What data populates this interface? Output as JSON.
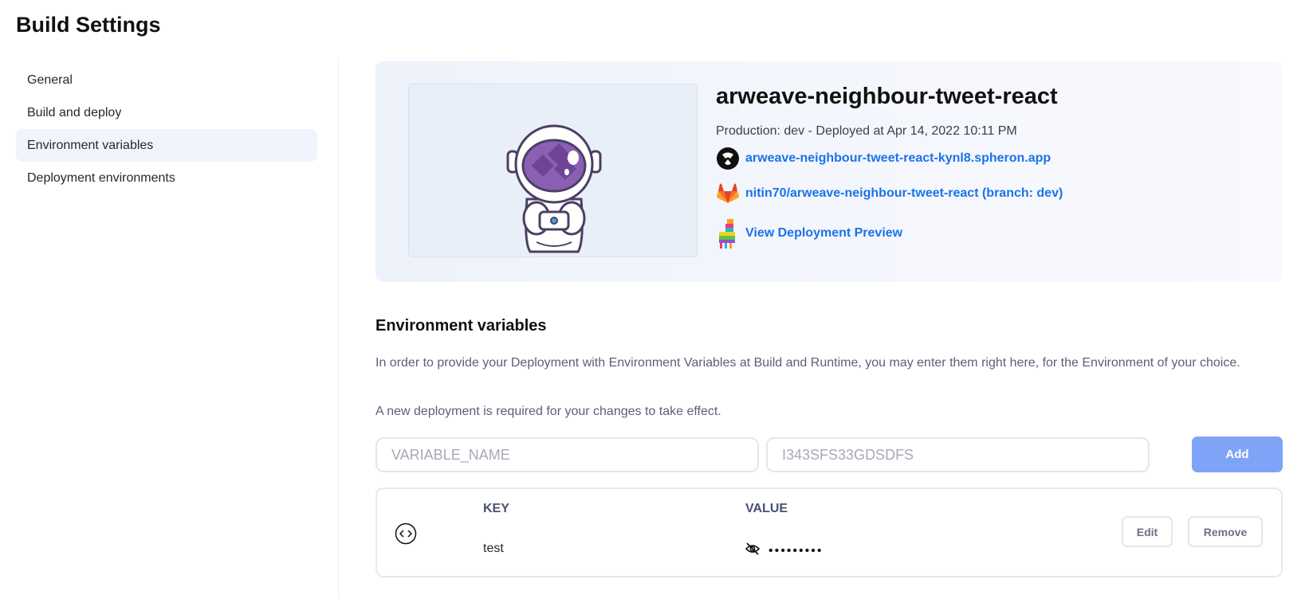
{
  "page_title": "Build Settings",
  "sidebar": {
    "items": [
      {
        "label": "General",
        "active": false
      },
      {
        "label": "Build and deploy",
        "active": false
      },
      {
        "label": "Environment variables",
        "active": true
      },
      {
        "label": "Deployment environments",
        "active": false
      }
    ]
  },
  "project": {
    "name": "arweave-neighbour-tweet-react",
    "production_line": "Production: dev - Deployed at Apr 14, 2022 10:11 PM",
    "domain_link": "arweave-neighbour-tweet-react-kynl8.spheron.app",
    "repo_link": "nitin70/arweave-neighbour-tweet-react (branch: dev)",
    "preview_link": "View Deployment Preview",
    "icons": {
      "domain": "spheron-logo-icon",
      "repo": "gitlab-icon",
      "preview": "llama-pinata-icon",
      "thumbnail": "astronaut-illustration"
    }
  },
  "env_section": {
    "title": "Environment variables",
    "description": "In order to provide your Deployment with Environment Variables at Build and Runtime, you may enter them right here, for the Environment of your choice.",
    "note": "A new deployment is required for your changes to take effect.",
    "key_placeholder": "VARIABLE_NAME",
    "value_placeholder": "I343SFS33GDSDFS",
    "add_label": "Add"
  },
  "env_table": {
    "headers": {
      "key": "KEY",
      "value": "VALUE"
    },
    "rows": [
      {
        "key": "test",
        "value_masked": "•••••••••",
        "edit_label": "Edit",
        "remove_label": "Remove"
      }
    ]
  },
  "colors": {
    "accent_link": "#1a73e8",
    "add_button": "#7fa3f7",
    "active_sidebar": "#f0f5fd"
  }
}
